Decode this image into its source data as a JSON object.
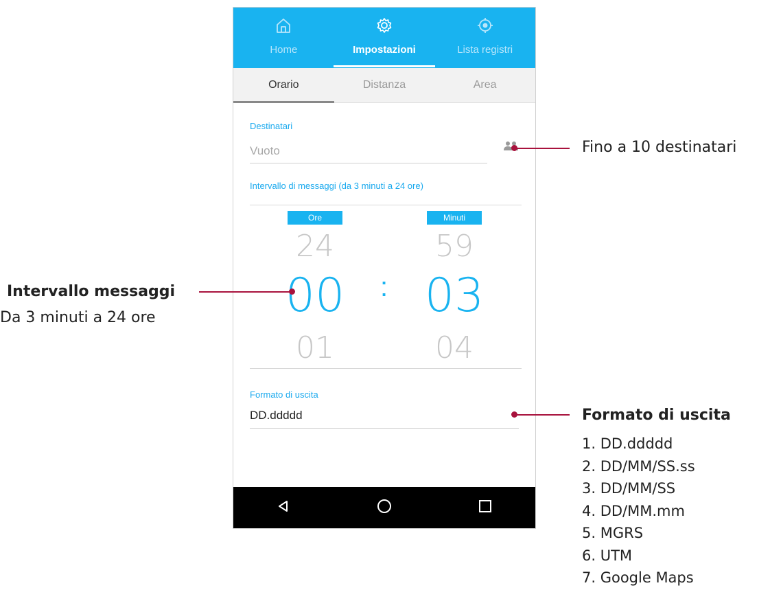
{
  "top_nav": [
    {
      "label": "Home",
      "icon": "home-icon",
      "active": false
    },
    {
      "label": "Impostazioni",
      "icon": "gear-icon",
      "active": true
    },
    {
      "label": "Lista registri",
      "icon": "target-icon",
      "active": false
    }
  ],
  "sub_tabs": [
    {
      "label": "Orario",
      "active": true
    },
    {
      "label": "Distanza",
      "active": false
    },
    {
      "label": "Area",
      "active": false
    }
  ],
  "recipients": {
    "label": "Destinatari",
    "placeholder": "Vuoto"
  },
  "interval": {
    "label": "Intervallo di messaggi (da 3 minuti a 24 ore)",
    "hours": {
      "tag": "Ore",
      "prev": "24",
      "current": "00",
      "next": "01"
    },
    "minutes": {
      "tag": "Minuti",
      "prev": "59",
      "current": "03",
      "next": "04"
    },
    "separator": ":"
  },
  "output_format": {
    "label": "Formato di uscita",
    "value": "DD.ddddd"
  },
  "annotations": {
    "recipients_note": "Fino a 10 destinatari",
    "interval_title": "Intervallo messaggi",
    "interval_text": "Da 3 minuti a 24 ore",
    "format_title": "Formato di uscita",
    "format_options": [
      "1. DD.ddddd",
      "2. DD/MM/SS.ss",
      "3. DD/MM/SS",
      "4. DD/MM.mm",
      "5. MGRS",
      "6. UTM",
      "7. Google Maps"
    ]
  },
  "colors": {
    "accent": "#19b3f0",
    "callout": "#a8123d",
    "nav_bar": "#000000"
  }
}
